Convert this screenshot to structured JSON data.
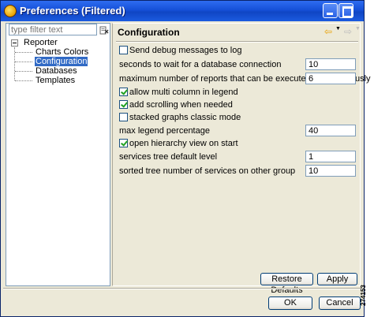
{
  "window": {
    "title": "Preferences (Filtered)"
  },
  "filter": {
    "placeholder": "type filter text"
  },
  "tree": {
    "root": "Reporter",
    "children": [
      "Charts Colors",
      "Configuration",
      "Databases",
      "Templates"
    ],
    "selected_index": 1
  },
  "page": {
    "title": "Configuration",
    "send_debug_label": "Send debug messages to log",
    "send_debug_checked": false,
    "db_wait_label": "seconds to wait for a database connection",
    "db_wait_value": "10",
    "max_reports_label": "maximum number of reports that can be executed simultaneously",
    "max_reports_value": "6",
    "multi_column_label": "allow multi column in legend",
    "multi_column_checked": true,
    "scrolling_label": "add scrolling when needed",
    "scrolling_checked": true,
    "stacked_classic_label": "stacked graphs classic mode",
    "stacked_classic_checked": false,
    "max_legend_label": "max legend percentage",
    "max_legend_value": "40",
    "open_hierarchy_label": "open hierarchy view on start",
    "open_hierarchy_checked": true,
    "services_level_label": "services tree default level",
    "services_level_value": "1",
    "sorted_tree_label": "sorted tree number of services on other group",
    "sorted_tree_value": "10"
  },
  "buttons": {
    "restore_defaults": "Restore Defaults",
    "apply": "Apply",
    "ok": "OK",
    "cancel": "Cancel"
  },
  "figure_code": "274153"
}
